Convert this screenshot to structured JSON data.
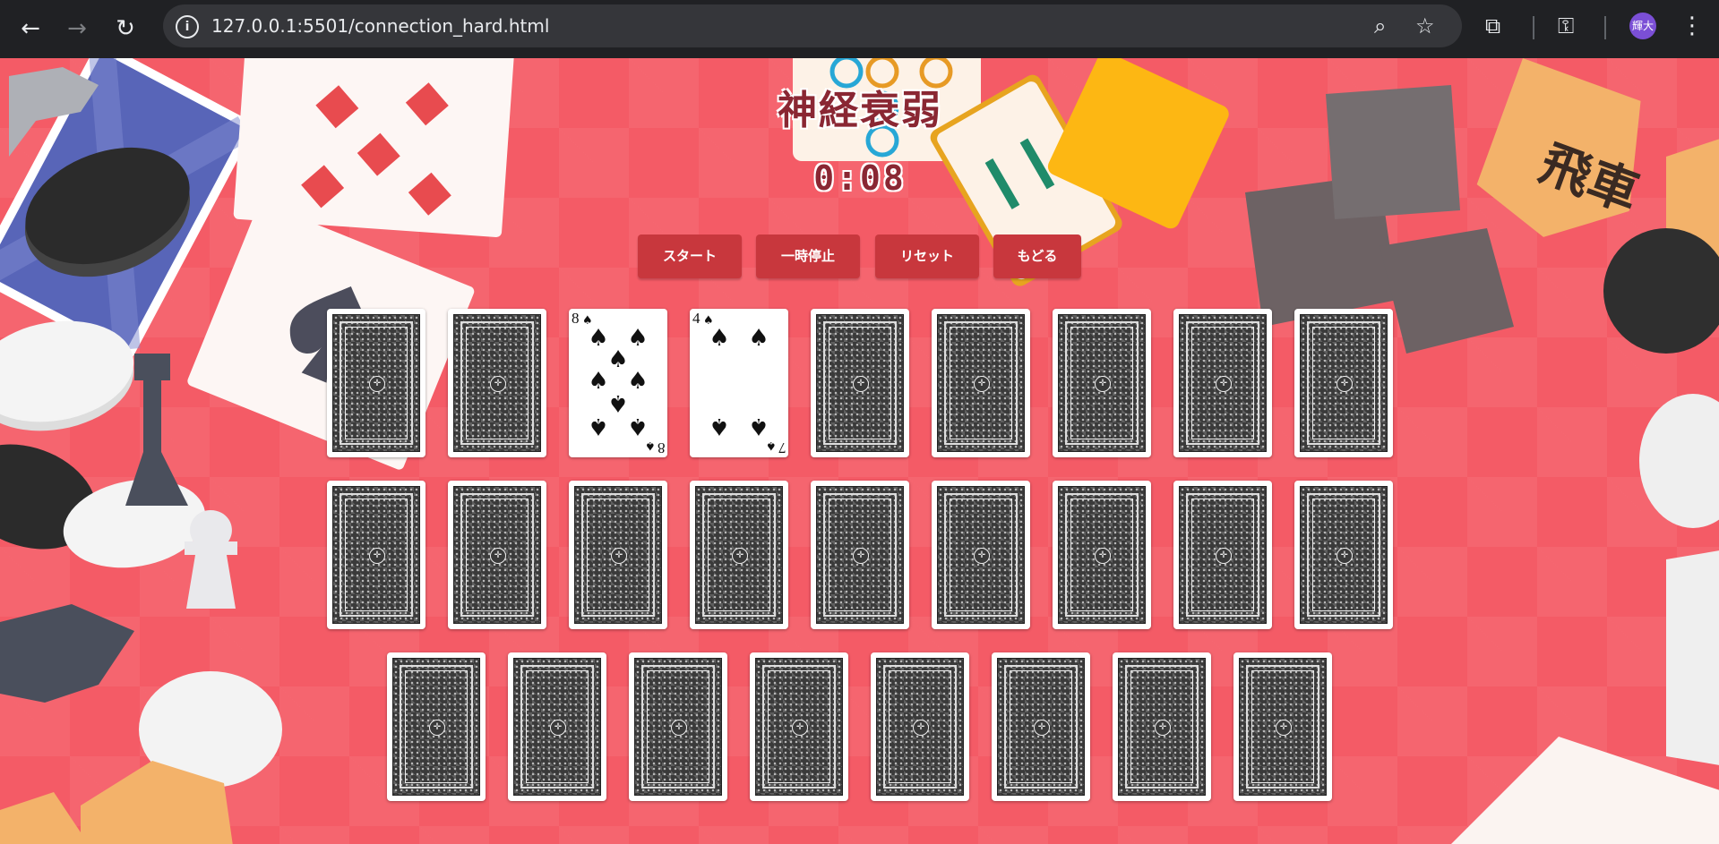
{
  "browser": {
    "url": "127.0.0.1:5501/connection_hard.html",
    "profile_initials": "輝大",
    "icons": {
      "back": "arrow-left-icon",
      "forward": "arrow-right-icon",
      "reload": "reload-icon",
      "site_info": "info-icon",
      "zoom": "zoom-icon",
      "bookmark": "star-icon",
      "extensions": "puzzle-icon",
      "passwords": "key-icon",
      "menu": "kebab-menu-icon"
    }
  },
  "game": {
    "title": "神経衰弱",
    "timer": "0:08",
    "buttons": {
      "start": "スタート",
      "pause": "一時停止",
      "reset": "リセット",
      "back": "もどる"
    },
    "face_up_cards": [
      {
        "rank": "8",
        "suit": "♠"
      },
      {
        "rank": "7",
        "suit": "♠"
      }
    ],
    "colors": {
      "background": "#f45b66",
      "button": "#c8373d",
      "title": "#8a2733"
    }
  }
}
